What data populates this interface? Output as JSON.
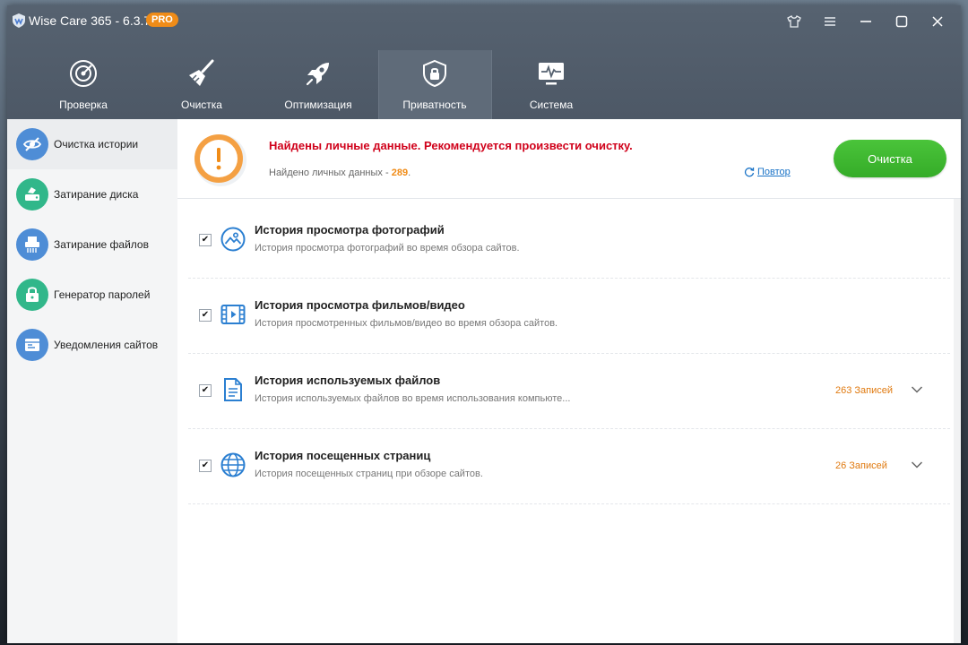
{
  "app": {
    "title": "Wise Care 365 - 6.3.7",
    "badge": "PRO"
  },
  "nav": {
    "tabs": [
      {
        "label": "Проверка",
        "icon": "radar-icon"
      },
      {
        "label": "Очистка",
        "icon": "broom-icon"
      },
      {
        "label": "Оптимизация",
        "icon": "rocket-icon"
      },
      {
        "label": "Приватность",
        "icon": "privacy-lock-icon",
        "active": true
      },
      {
        "label": "Система",
        "icon": "monitor-icon"
      }
    ]
  },
  "sidebar": {
    "items": [
      {
        "label": "Очистка истории",
        "icon": "eye-off-icon",
        "active": true
      },
      {
        "label": "Затирание диска",
        "icon": "disk-eraser-icon"
      },
      {
        "label": "Затирание файлов",
        "icon": "shredder-icon"
      },
      {
        "label": "Генератор паролей",
        "icon": "password-lock-icon"
      },
      {
        "label": "Уведомления сайтов",
        "icon": "site-notification-icon"
      }
    ]
  },
  "banner": {
    "title": "Найдены личные данные. Рекомендуется произвести очистку.",
    "found_label": "Найдено личных данных - ",
    "found_count": "289",
    "found_suffix": ".",
    "retry_label": "Повтор",
    "clean_button": "Очистка"
  },
  "items": [
    {
      "title": "История просмотра фотографий",
      "desc": "История просмотра фотографий во время обзора сайтов.",
      "count": "",
      "checked": true,
      "icon": "photo-icon"
    },
    {
      "title": "История просмотра фильмов/видео",
      "desc": "История просмотренных фильмов/видео во время обзора сайтов.",
      "count": "",
      "checked": true,
      "icon": "film-icon"
    },
    {
      "title": "История используемых файлов",
      "desc": "История используемых файлов во время использования компьюте...",
      "count": "263 Записей",
      "checked": true,
      "icon": "document-icon"
    },
    {
      "title": "История посещенных страниц",
      "desc": "История посещенных страниц при обзоре сайтов.",
      "count": "26 Записей",
      "checked": true,
      "icon": "globe-icon"
    }
  ],
  "colors": {
    "header": "#566270",
    "accent_green": "#3cb52e",
    "warning_orange": "#f08c18",
    "alert_red": "#d0021b",
    "link_blue": "#1a73c7"
  }
}
